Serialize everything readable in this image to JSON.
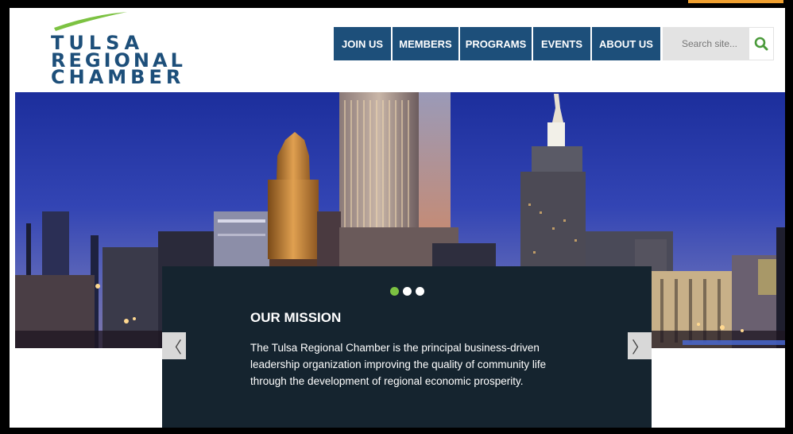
{
  "logo": {
    "line1": "TULSA",
    "line2": "REGIONAL",
    "line3": "CHAMBER",
    "swoosh_color": "#7cc242",
    "text_color": "#1d4f7a"
  },
  "nav": {
    "items": [
      {
        "label": "JOIN US"
      },
      {
        "label": "MEMBERS"
      },
      {
        "label": "PROGRAMS"
      },
      {
        "label": "EVENTS"
      },
      {
        "label": "ABOUT US"
      }
    ],
    "color": "#1d4f7a"
  },
  "search": {
    "placeholder": "Search site...",
    "icon": "search-icon",
    "icon_color": "#4a9a3a"
  },
  "hero": {
    "carousel_dots": 3,
    "active_dot": 0,
    "prev_icon": "chevron-left-icon",
    "next_icon": "chevron-right-icon",
    "prev_symbol": "〈",
    "next_symbol": "〉"
  },
  "mission": {
    "title": "OUR MISSION",
    "text": "The Tulsa Regional Chamber is the principal business-driven leadership organization improving the quality of community life through the development of regional economic prosperity.",
    "panel_color": "#15242f",
    "active_dot_color": "#7cc242"
  }
}
